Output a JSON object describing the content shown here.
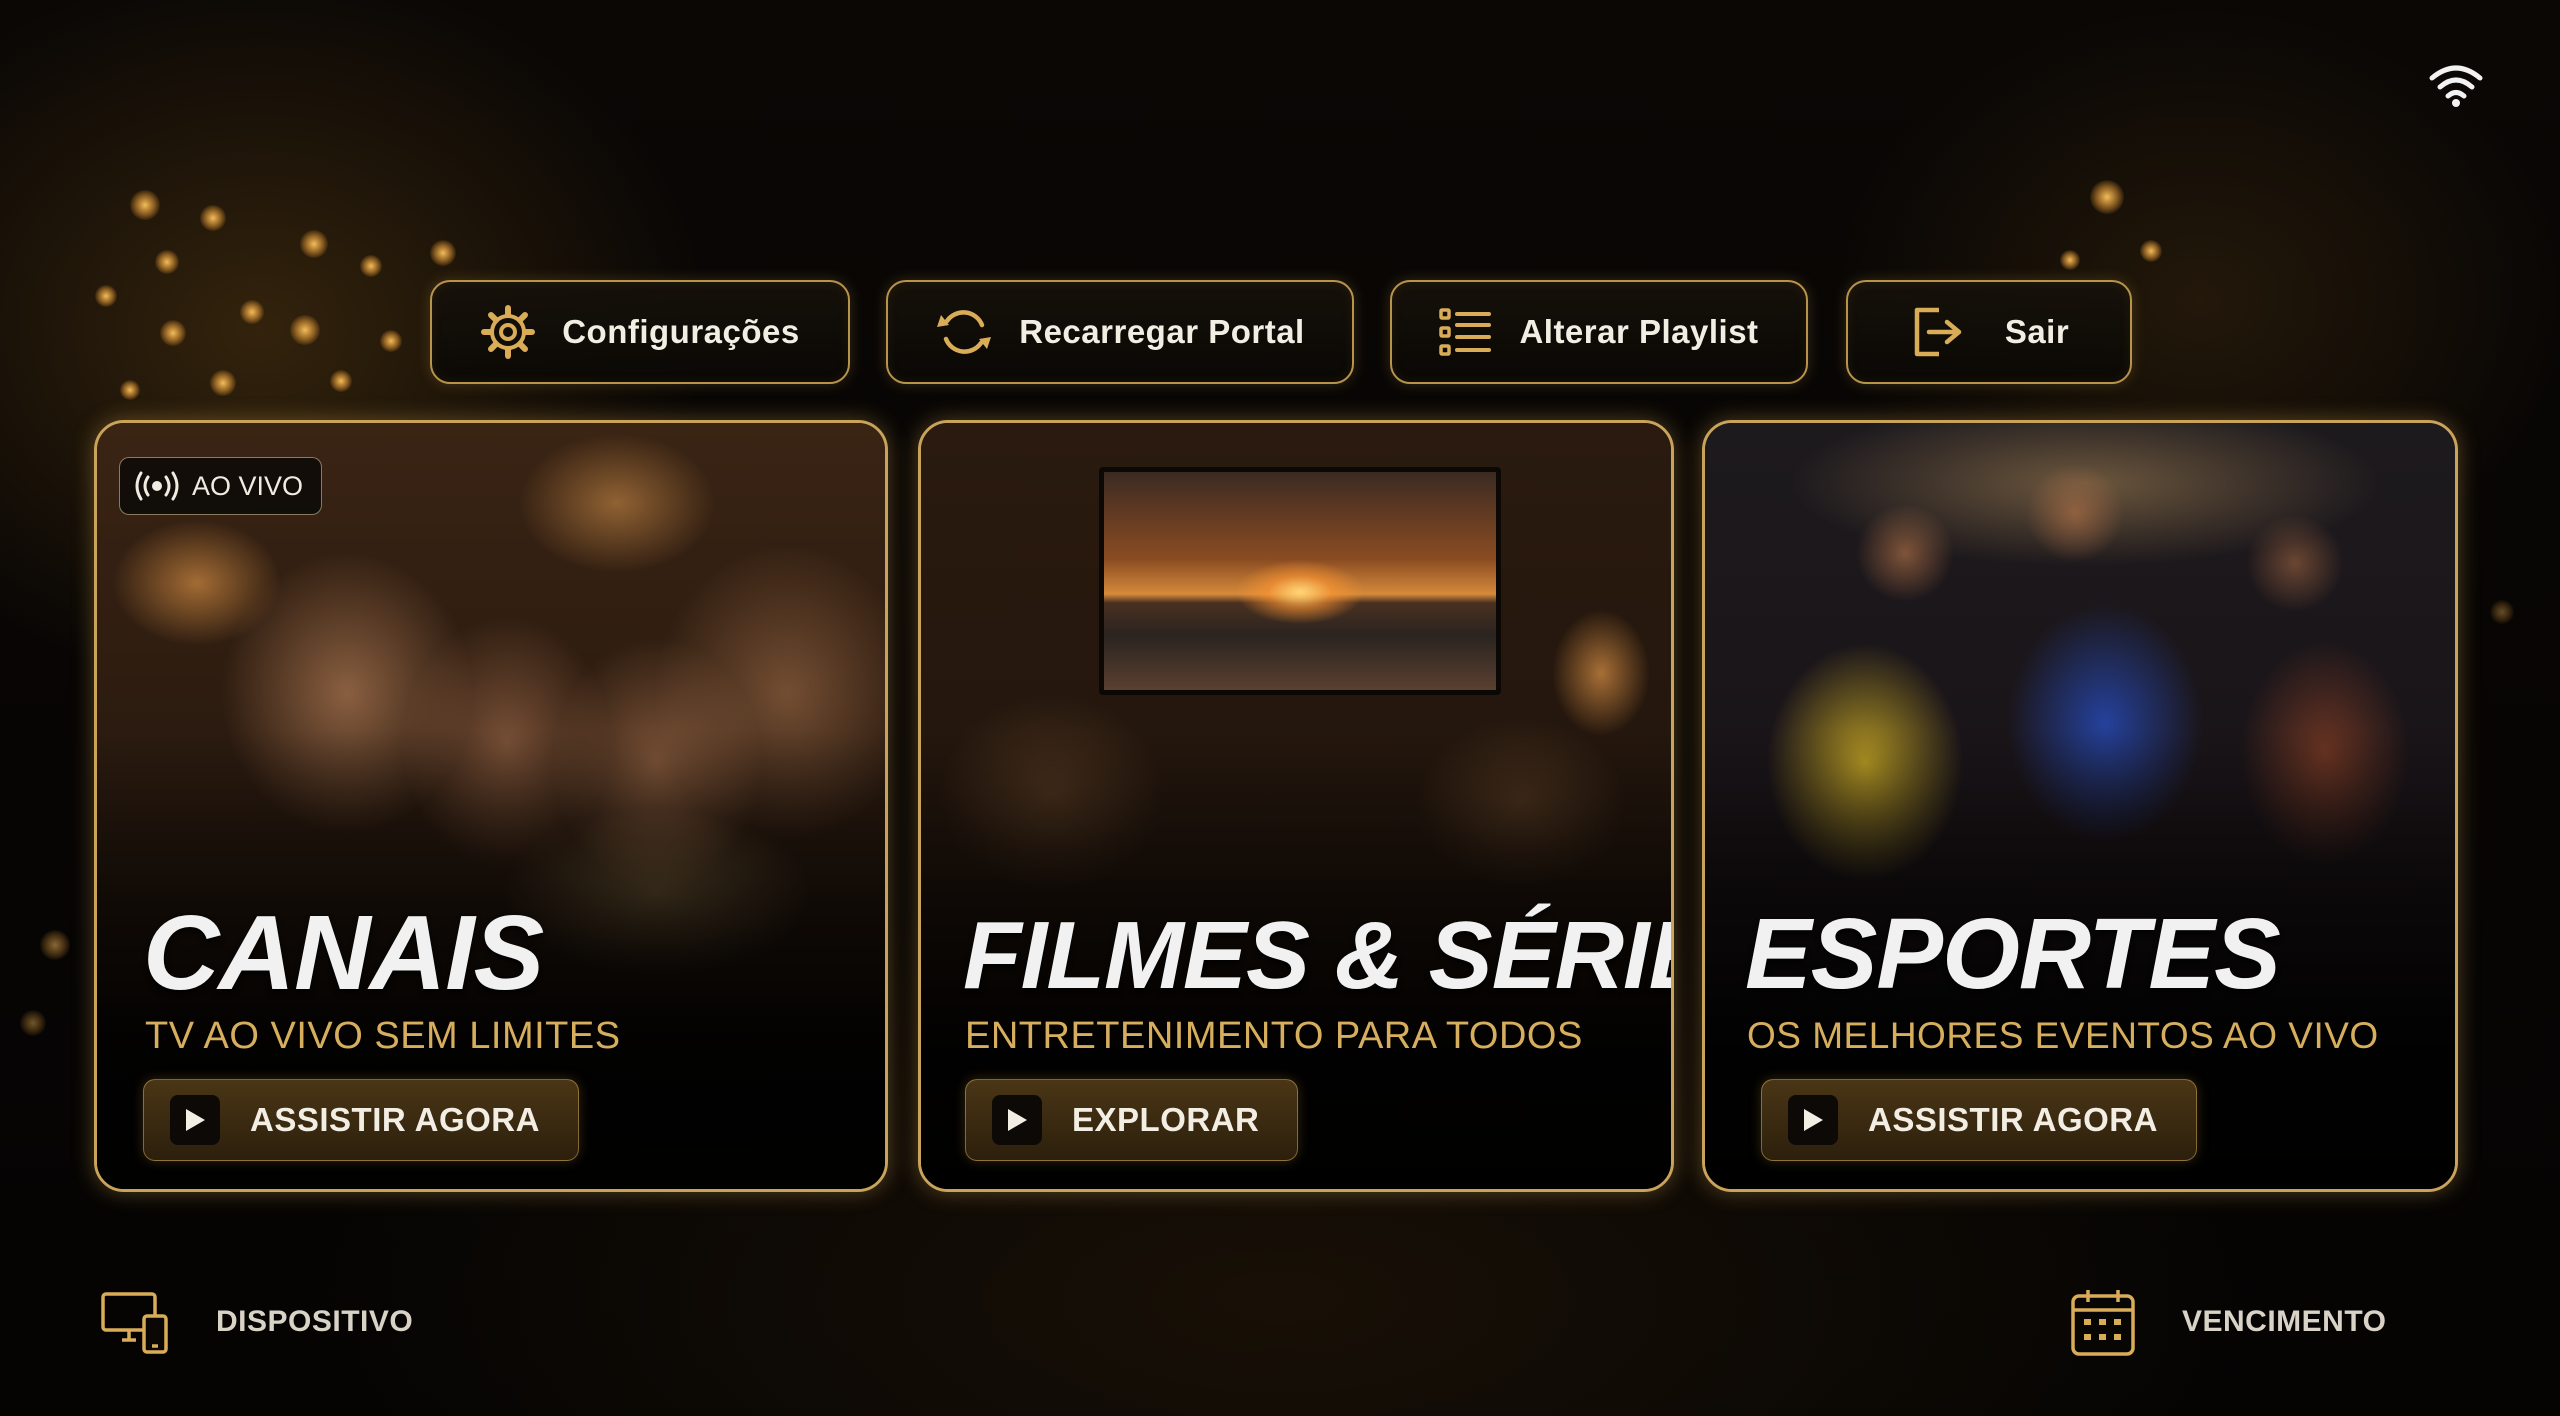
{
  "status": {
    "wifi_icon": "wifi-icon"
  },
  "nav": [
    {
      "label": "Configurações",
      "icon": "gear-icon"
    },
    {
      "label": "Recarregar Portal",
      "icon": "refresh-icon"
    },
    {
      "label": "Alterar Playlist",
      "icon": "playlist-icon"
    },
    {
      "label": "Sair",
      "icon": "logout-icon"
    }
  ],
  "cards": [
    {
      "title": "CANAIS",
      "subtitle": "TV AO VIVO SEM LIMITES",
      "cta": "ASSISTIR AGORA",
      "badge": "AO VIVO"
    },
    {
      "title": "FILMES & SÉRIES",
      "subtitle": "ENTRETENIMENTO PARA TODOS",
      "cta": "EXPLORAR"
    },
    {
      "title": "ESPORTES",
      "subtitle": "OS MELHORES EVENTOS AO VIVO",
      "cta": "ASSISTIR AGORA"
    }
  ],
  "footer": {
    "device_label": "DISPOSITIVO",
    "expiry_label": "VENCIMENTO"
  },
  "colors": {
    "accent_gold": "#c9a35a",
    "subtitle_gold": "#d7ae5e",
    "background": "#060403",
    "text": "#f3eee4"
  }
}
